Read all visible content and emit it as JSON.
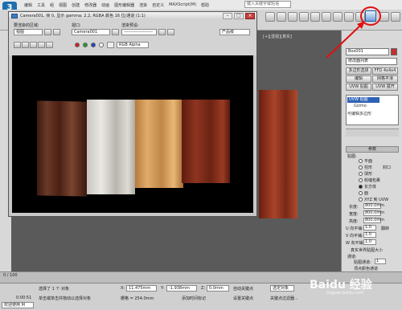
{
  "menubar": {
    "items": [
      "编辑",
      "工具",
      "组",
      "视图",
      "创建",
      "修改器",
      "动画",
      "图形编辑器",
      "渲染",
      "自定义",
      "MAXScript(M)",
      "帮助"
    ],
    "search_placeholder": "键入关键字或短语"
  },
  "app_logo": "3",
  "viewport": {
    "label": "[+][透视][真实]"
  },
  "render_window": {
    "title": "Camera001, 帧 0, 显示 gamma: 2.2, RGBA 颜色 16 位/通道 (1:1)",
    "area_to_render_label": "要渲染的区域:",
    "area_to_render_value": "视图",
    "viewport_label": "视口:",
    "viewport_value": "Camera001",
    "render_preset_label": "渲染预设:",
    "render_preset_value": "--------------------",
    "production_label": "产品级",
    "channel_value": "RGB Alpha"
  },
  "command_panel": {
    "name_value": "Box001",
    "modifier_list": "修改器列表",
    "buttons": [
      "多边形选择",
      "FFD 4x4x4",
      "编辑",
      "网格平滑",
      "UVW 贴图",
      "UVW 展开",
      "挤出",
      "弯曲"
    ],
    "stack_items": [
      "UVW 贴图",
      "Gizmo",
      "可编辑多边形"
    ],
    "params_title": "参数",
    "mapping_label": "贴图:",
    "mapping_options": [
      "平面",
      "柱形",
      "封口",
      "球形",
      "收缩包裹",
      "长方体",
      "面",
      "XYZ 到 UVW"
    ],
    "length_label": "长度:",
    "length_value": "800.0mm",
    "width_label": "宽度:",
    "width_value": "800.0mm",
    "height_label": "高度:",
    "height_value": "800.0mm",
    "u_tile_label": "U 向平铺:",
    "u_tile_value": "1.0",
    "v_tile_label": "V 向平铺:",
    "v_tile_value": "1.0",
    "w_tile_label": "W 向平铺:",
    "w_tile_value": "1.0",
    "flip_label": "翻转",
    "real_world_label": "真实世界贴图大小",
    "channel_label": "通道:",
    "map_channel_label": "贴图通道:",
    "map_channel_value": "1",
    "vertex_color_label": "顶点颜色通道",
    "display_label": "显示:"
  },
  "timeline": {
    "label": "0 / 100"
  },
  "status_bar": {
    "prompt": "选择了 1 个 对象",
    "hint": "单击或单击并拖动以选择对象",
    "x_label": "X:",
    "x_value": "11.475mm",
    "y_label": "Y:",
    "y_value": "-1.938mm",
    "z_label": "Z:",
    "z_value": "0.0mm",
    "grid_label": "栅格 = 254.0mm",
    "auto_key": "自动关键点",
    "selected": "选定对象",
    "set_key": "设置关键点",
    "filters": "关键点过滤器...",
    "add_time_tag": "添加时间标记",
    "time": "0:00:51",
    "welcome": "欢迎使用 M"
  },
  "watermark": {
    "brand": "Baidu 经验",
    "sub": "jingyan.baidu.com"
  },
  "colors": {
    "highlight": "#e01010",
    "render_bg": "#000000",
    "accent": "#2e62b6"
  }
}
